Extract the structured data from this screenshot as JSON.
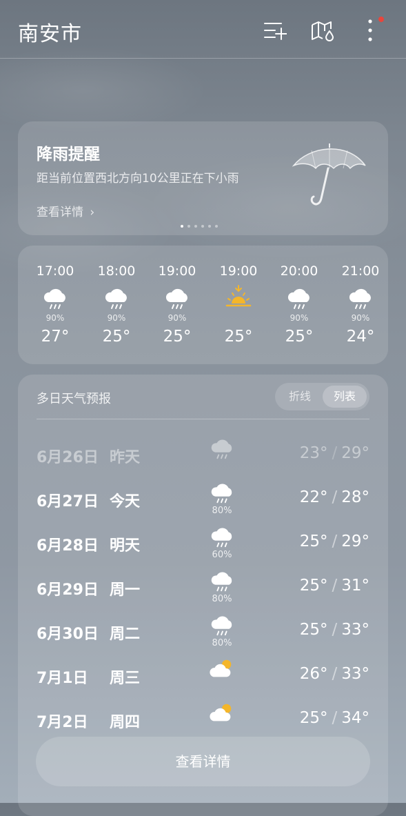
{
  "header": {
    "city": "南安市"
  },
  "alert": {
    "title": "降雨提醒",
    "description": "距当前位置西北方向10公里正在下小雨",
    "link": "查看详情"
  },
  "hourly": [
    {
      "time": "17:00",
      "icon": "rain-cloud-icon",
      "precip": "90%",
      "temp": "27°"
    },
    {
      "time": "18:00",
      "icon": "rain-cloud-icon",
      "precip": "90%",
      "temp": "25°"
    },
    {
      "time": "19:00",
      "icon": "rain-cloud-icon",
      "precip": "90%",
      "temp": "25°"
    },
    {
      "time": "19:00",
      "icon": "sunset-icon",
      "precip": "",
      "temp": "25°"
    },
    {
      "time": "20:00",
      "icon": "rain-cloud-icon",
      "precip": "90%",
      "temp": "25°"
    },
    {
      "time": "21:00",
      "icon": "rain-cloud-icon",
      "precip": "90%",
      "temp": "24°"
    }
  ],
  "daily": {
    "title": "多日天气预报",
    "toggle_line": "折线",
    "toggle_list": "列表",
    "detail_button": "查看详情",
    "days": [
      {
        "date": "6月26日",
        "weekday": "昨天",
        "icon": "rain-cloud-icon",
        "precip": "",
        "low": "23°",
        "high": "29°"
      },
      {
        "date": "6月27日",
        "weekday": "今天",
        "icon": "rain-cloud-icon",
        "precip": "80%",
        "low": "22°",
        "high": "28°"
      },
      {
        "date": "6月28日",
        "weekday": "明天",
        "icon": "rain-cloud-icon",
        "precip": "60%",
        "low": "25°",
        "high": "29°"
      },
      {
        "date": "6月29日",
        "weekday": "周一",
        "icon": "rain-cloud-icon",
        "precip": "80%",
        "low": "25°",
        "high": "31°"
      },
      {
        "date": "6月30日",
        "weekday": "周二",
        "icon": "rain-cloud-icon",
        "precip": "80%",
        "low": "25°",
        "high": "33°"
      },
      {
        "date": "7月1日",
        "weekday": "周三",
        "icon": "partly-cloudy-icon",
        "precip": "",
        "low": "26°",
        "high": "33°"
      },
      {
        "date": "7月2日",
        "weekday": "周四",
        "icon": "partly-cloudy-icon",
        "precip": "",
        "low": "25°",
        "high": "34°"
      }
    ]
  },
  "colors": {
    "sun": "#f4b62a",
    "alert_dot": "#e8453c"
  }
}
